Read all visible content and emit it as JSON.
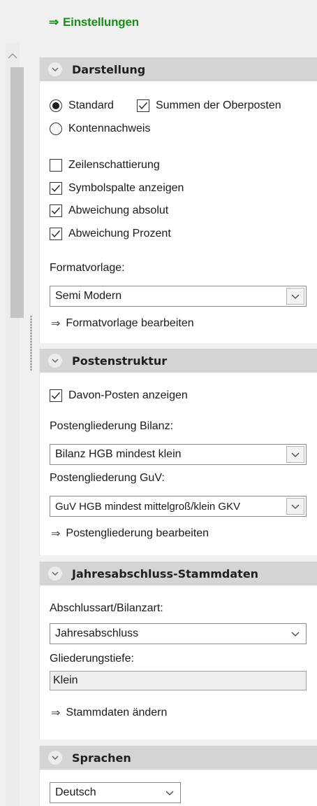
{
  "settings_link": {
    "arrow": "⇒",
    "label": "Einstellungen"
  },
  "icons": {
    "arrow": "⇒",
    "check": "check-mark",
    "chevron": "chevron-down"
  },
  "colors": {
    "accent_green": "#1e8b1e",
    "header_bg": "#d4d4d4"
  },
  "darstellung": {
    "title": "Darstellung",
    "radio_standard": "Standard",
    "checkbox_summen": "Summen der Oberposten",
    "radio_kontennachweis": "Kontennachweis",
    "checkbox_zeilen": "Zeilenschattierung",
    "checkbox_symbol": "Symbolspalte anzeigen",
    "checkbox_abw_abs": "Abweichung absolut",
    "checkbox_abw_proz": "Abweichung Prozent",
    "format_label": "Formatvorlage:",
    "format_value": "Semi Modern",
    "format_link": "Formatvorlage bearbeiten"
  },
  "postenstruktur": {
    "title": "Postenstruktur",
    "checkbox_davon": "Davon-Posten anzeigen",
    "bilanz_label": "Postengliederung Bilanz:",
    "bilanz_value": "Bilanz HGB mindest klein",
    "guv_label": "Postengliederung GuV:",
    "guv_value": "GuV HGB mindest mittelgroß/klein GKV",
    "edit_link": "Postengliederung bearbeiten"
  },
  "stammdaten": {
    "title": "Jahresabschluss-Stammdaten",
    "abschluss_label": "Abschlussart/Bilanzart:",
    "abschluss_value": "Jahresabschluss",
    "tiefe_label": "Gliederungstiefe:",
    "tiefe_value": "Klein",
    "edit_link": "Stammdaten ändern"
  },
  "sprachen": {
    "title": "Sprachen",
    "language_value": "Deutsch"
  }
}
